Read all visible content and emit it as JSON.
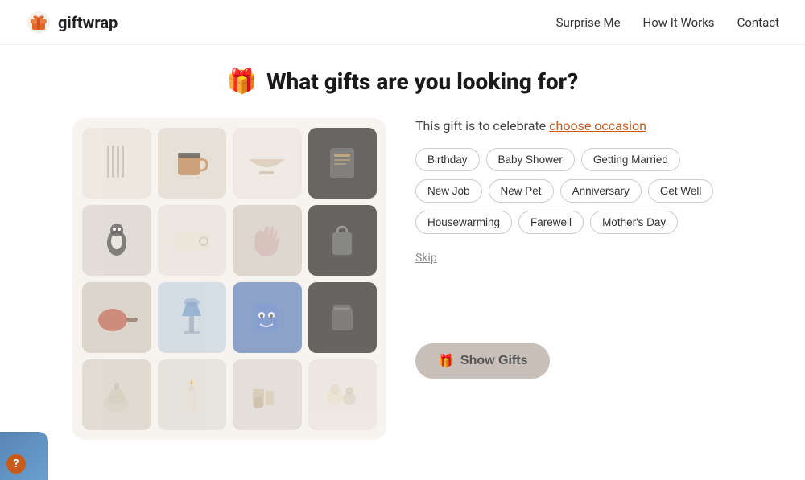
{
  "nav": {
    "logo_text": "giftwrap",
    "links": [
      {
        "id": "surprise",
        "label": "Surprise Me"
      },
      {
        "id": "how-it-works",
        "label": "How It Works"
      },
      {
        "id": "contact",
        "label": "Contact"
      }
    ]
  },
  "page": {
    "title_emoji": "🎁",
    "title": "What gifts are you looking for?"
  },
  "occasion_selector": {
    "prompt": "This gift is to celebrate ",
    "choose_label": "choose occasion",
    "tags_row1": [
      "Birthday",
      "Baby Shower",
      "Getting Married"
    ],
    "tags_row2": [
      "New Job",
      "New Pet",
      "Anniversary",
      "Get Well"
    ],
    "tags_row3": [
      "Housewarming",
      "Farewell",
      "Mother's Day"
    ],
    "skip_label": "Skip"
  },
  "show_gifts_button": {
    "emoji": "🎁",
    "label": "Show Gifts"
  },
  "grid_cells": [
    "utensils",
    "mug",
    "bowl",
    "tea",
    "penguin",
    "cutting",
    "gloves",
    "bag",
    "pan",
    "lamp2",
    "monster",
    "pouch",
    "diffuser",
    "candle",
    "figures",
    "animals"
  ]
}
